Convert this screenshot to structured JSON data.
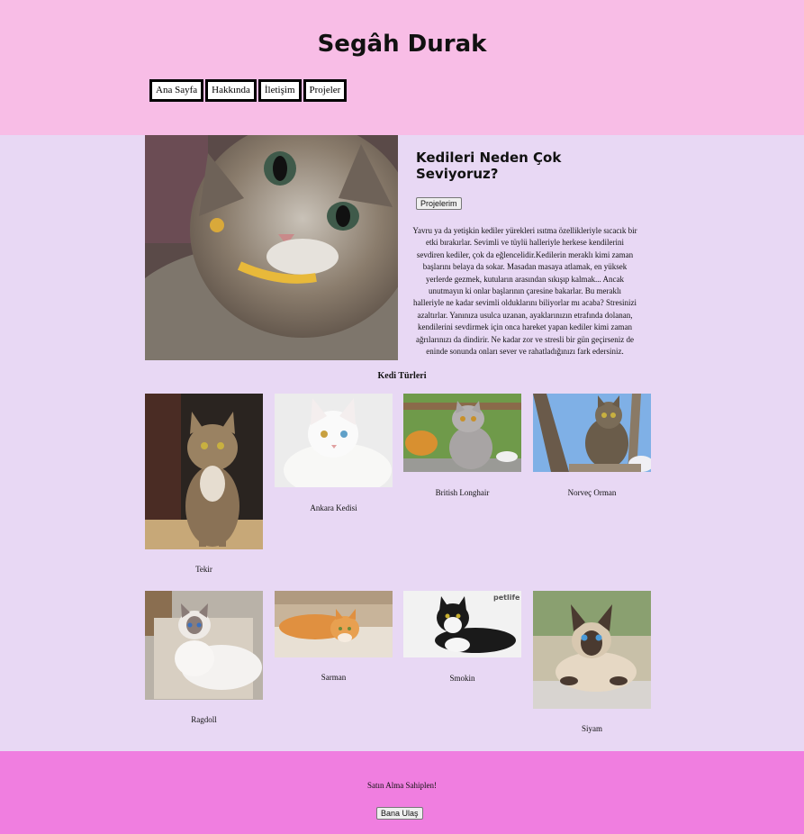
{
  "header": {
    "title": "Segâh Durak",
    "nav": [
      "Ana Sayfa",
      "Hakkında",
      "İletişim",
      "Projeler"
    ]
  },
  "hero": {
    "heading": "Kedileri Neden Çok Seviyoruz?",
    "button": "Projelerim",
    "paragraph": "Yavru ya da yetişkin kediler yürekleri ısıtma özellikleriyle sıcacık bir etki bırakırlar. Sevimli ve tüylü halleriyle herkese kendilerini sevdiren kediler, çok da eğlencelidir.Kedilerin meraklı kimi zaman başlarını belaya da sokar. Masadan masaya atlamak, en yüksek yerlerde gezmek, kutuların arasından sıkışıp kalmak... Ancak unutmayın ki onlar başlarının çaresine bakarlar. Bu meraklı halleriyle ne kadar sevimli olduklarını biliyorlar mı acaba? Stresinizi azaltırlar. Yanınıza usulca uzanan, ayaklarınızın etrafında dolanan, kendilerini sevdirmek için onca hareket yapan kediler kimi zaman ağrılarınızı da dindirir. Ne kadar zor ve stresli bir gün geçirseniz de eninde sonunda onları sever ve rahatladığınızı fark edersiniz."
  },
  "breeds": {
    "title": "Kedi Türleri",
    "items": [
      {
        "name": "Tekir",
        "icon": "tabby-cat-photo"
      },
      {
        "name": "Ankara Kedisi",
        "icon": "white-angora-cat-photo"
      },
      {
        "name": "British Longhair",
        "icon": "grey-longhair-cat-photo"
      },
      {
        "name": "Norveç Orman",
        "icon": "norwegian-forest-cat-photo"
      },
      {
        "name": "Ragdoll",
        "icon": "ragdoll-cat-photo"
      },
      {
        "name": "Sarman",
        "icon": "orange-cat-photo"
      },
      {
        "name": "Smokin",
        "icon": "tuxedo-cat-photo"
      },
      {
        "name": "Siyam",
        "icon": "siamese-cat-photo"
      }
    ],
    "photo_watermark": "petlife"
  },
  "footer": {
    "tagline": "Satın Alma Sahiplen!",
    "button": "Bana Ulaş"
  },
  "colors": {
    "header_bg": "#f8bde6",
    "body_bg": "#e8d8f4",
    "footer_bg": "#f07ee0"
  }
}
